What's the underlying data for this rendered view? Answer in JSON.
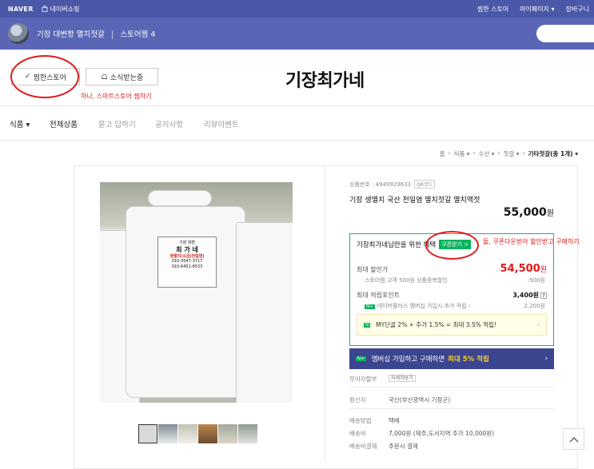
{
  "topbar": {
    "naver": "NAVER",
    "shop": "네이버쇼핑",
    "links": [
      "찜한 스토어",
      "마이페이지",
      "장바구니"
    ]
  },
  "store": {
    "name": "기장 대변항 멸치젓갈",
    "zoom": "스토어찜 4"
  },
  "buttons": {
    "jjim": "찜한스토어",
    "news": "소식받는중"
  },
  "annotations": {
    "one": "하나, 스마트스토어 찜하기",
    "two": "둘, 쿠폰다운받아 할인받고 구매하기"
  },
  "brand": "기장최가네",
  "nav": {
    "category": "식품",
    "all": "전체상품",
    "qna": "묻고 답하기",
    "notice": "공지사항",
    "review": "리뷰이벤트"
  },
  "breadcrumb": [
    "홈",
    "식품",
    "수산",
    "젓갈",
    "기타젓갈(총 1개)"
  ],
  "product": {
    "sku_label": "상품번호 : 4949929633",
    "qr": "QR코드",
    "name": "기장 생멸치 국산 천일염 멸치젓갈 멸치액젓",
    "price": "55,000",
    "won": "원"
  },
  "image_label": {
    "line1": "기장 대변",
    "line2": "최 가 네",
    "line3": "생멸치/소금(천일염)",
    "line4": "010-3547-3717",
    "line5": "010-6451-6533"
  },
  "coupon": {
    "head": "기장최가네님만을 위한 혜택",
    "button": "쿠폰받기 >",
    "max_discount_label": "최대 할인가",
    "max_discount": "54,500",
    "won": "원",
    "sub1": "스토어찜 고객 500원 상품중복할인",
    "sub1_val": "-500원",
    "max_point_label": "최대 적립포인트",
    "max_point": "3,400원",
    "nplus": "네이버플러스 멤버십 가입시 추가 적립",
    "nplus_val": "2,200원",
    "my": "MY단골 2% + 추가 1.5% = 최대 3.5% 적립!"
  },
  "membership": {
    "text": "멤버십 가입하고 구매하면",
    "highlight": "최대 5% 적립"
  },
  "info": {
    "interest_label": "무이자할부",
    "interest_btn": "자세히보기",
    "origin_label": "원산지",
    "origin": "국산(부산광역시 기장군)",
    "ship_label": "배송방법",
    "ship": "택배",
    "fee_label": "배송비",
    "fee": "7,000원 (제주,도서지역 추가 10,000원)",
    "pay_label": "배송비결제",
    "pay": "주문시 결제"
  }
}
